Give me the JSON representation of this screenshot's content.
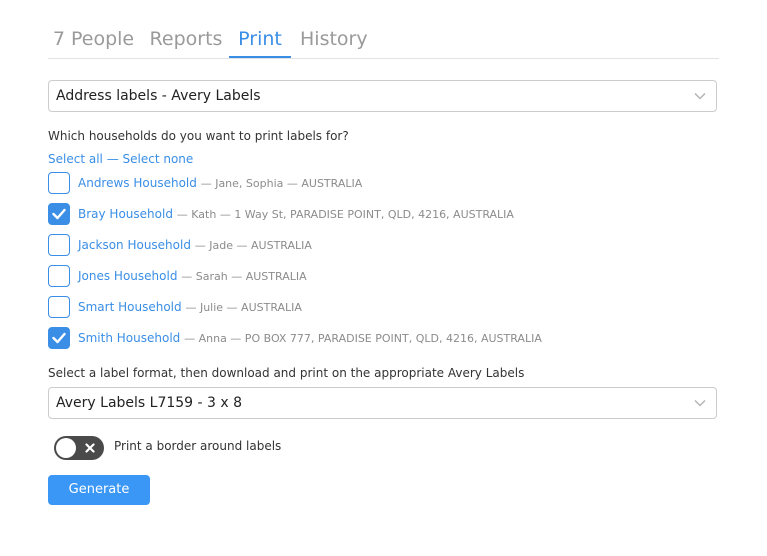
{
  "tabs": [
    {
      "label": "7 People",
      "active": false
    },
    {
      "label": "Reports",
      "active": false
    },
    {
      "label": "Print",
      "active": true
    },
    {
      "label": "History",
      "active": false
    }
  ],
  "label_type_select": {
    "value": "Address labels - Avery Labels"
  },
  "households_question": "Which households do you want to print labels for?",
  "select_links": {
    "select_all": "Select all",
    "separator": "—",
    "select_none": "Select none"
  },
  "households": [
    {
      "name": "Andrews Household",
      "details": "— Jane, Sophia — AUSTRALIA",
      "checked": false
    },
    {
      "name": "Bray Household",
      "details": "— Kath — 1 Way St, PARADISE POINT, QLD, 4216, AUSTRALIA",
      "checked": true
    },
    {
      "name": "Jackson Household",
      "details": "— Jade — AUSTRALIA",
      "checked": false
    },
    {
      "name": "Jones Household",
      "details": "— Sarah — AUSTRALIA",
      "checked": false
    },
    {
      "name": "Smart Household",
      "details": "— Julie — AUSTRALIA",
      "checked": false
    },
    {
      "name": "Smith Household",
      "details": "— Anna — PO BOX 777, PARADISE POINT, QLD, 4216, AUSTRALIA",
      "checked": true
    }
  ],
  "format_instructions": "Select a label format, then download and print on the appropriate Avery Labels",
  "label_format_select": {
    "value": "Avery Labels L7159 - 3 x 8"
  },
  "border_toggle": {
    "label": "Print a border around labels",
    "on": false
  },
  "generate_button": {
    "label": "Generate"
  },
  "colors": {
    "accent": "#3a8ee6",
    "button": "#3a97f5",
    "toggle_off": "#4a4a4a"
  },
  "icons": {
    "select_arrow": "chevron-down-icon",
    "checkbox_mark": "checkmark-icon",
    "toggle_mark": "x-icon"
  }
}
